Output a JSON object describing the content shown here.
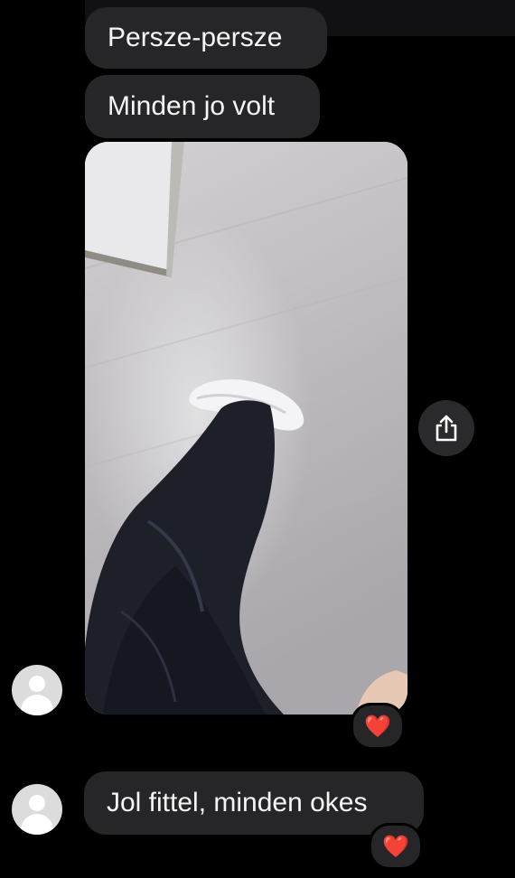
{
  "messages": [
    {
      "text": "Persze-persze"
    },
    {
      "text": "Minden jo volt"
    },
    {
      "text": "Jol fittel, minden okes"
    }
  ],
  "reactions": {
    "photo": "❤️",
    "last_message": "❤️"
  },
  "icons": {
    "share": "share-icon",
    "avatar": "default-avatar-icon"
  },
  "colors": {
    "background": "#000000",
    "bubble": "#262628",
    "reaction_heart": "#e8262c"
  }
}
